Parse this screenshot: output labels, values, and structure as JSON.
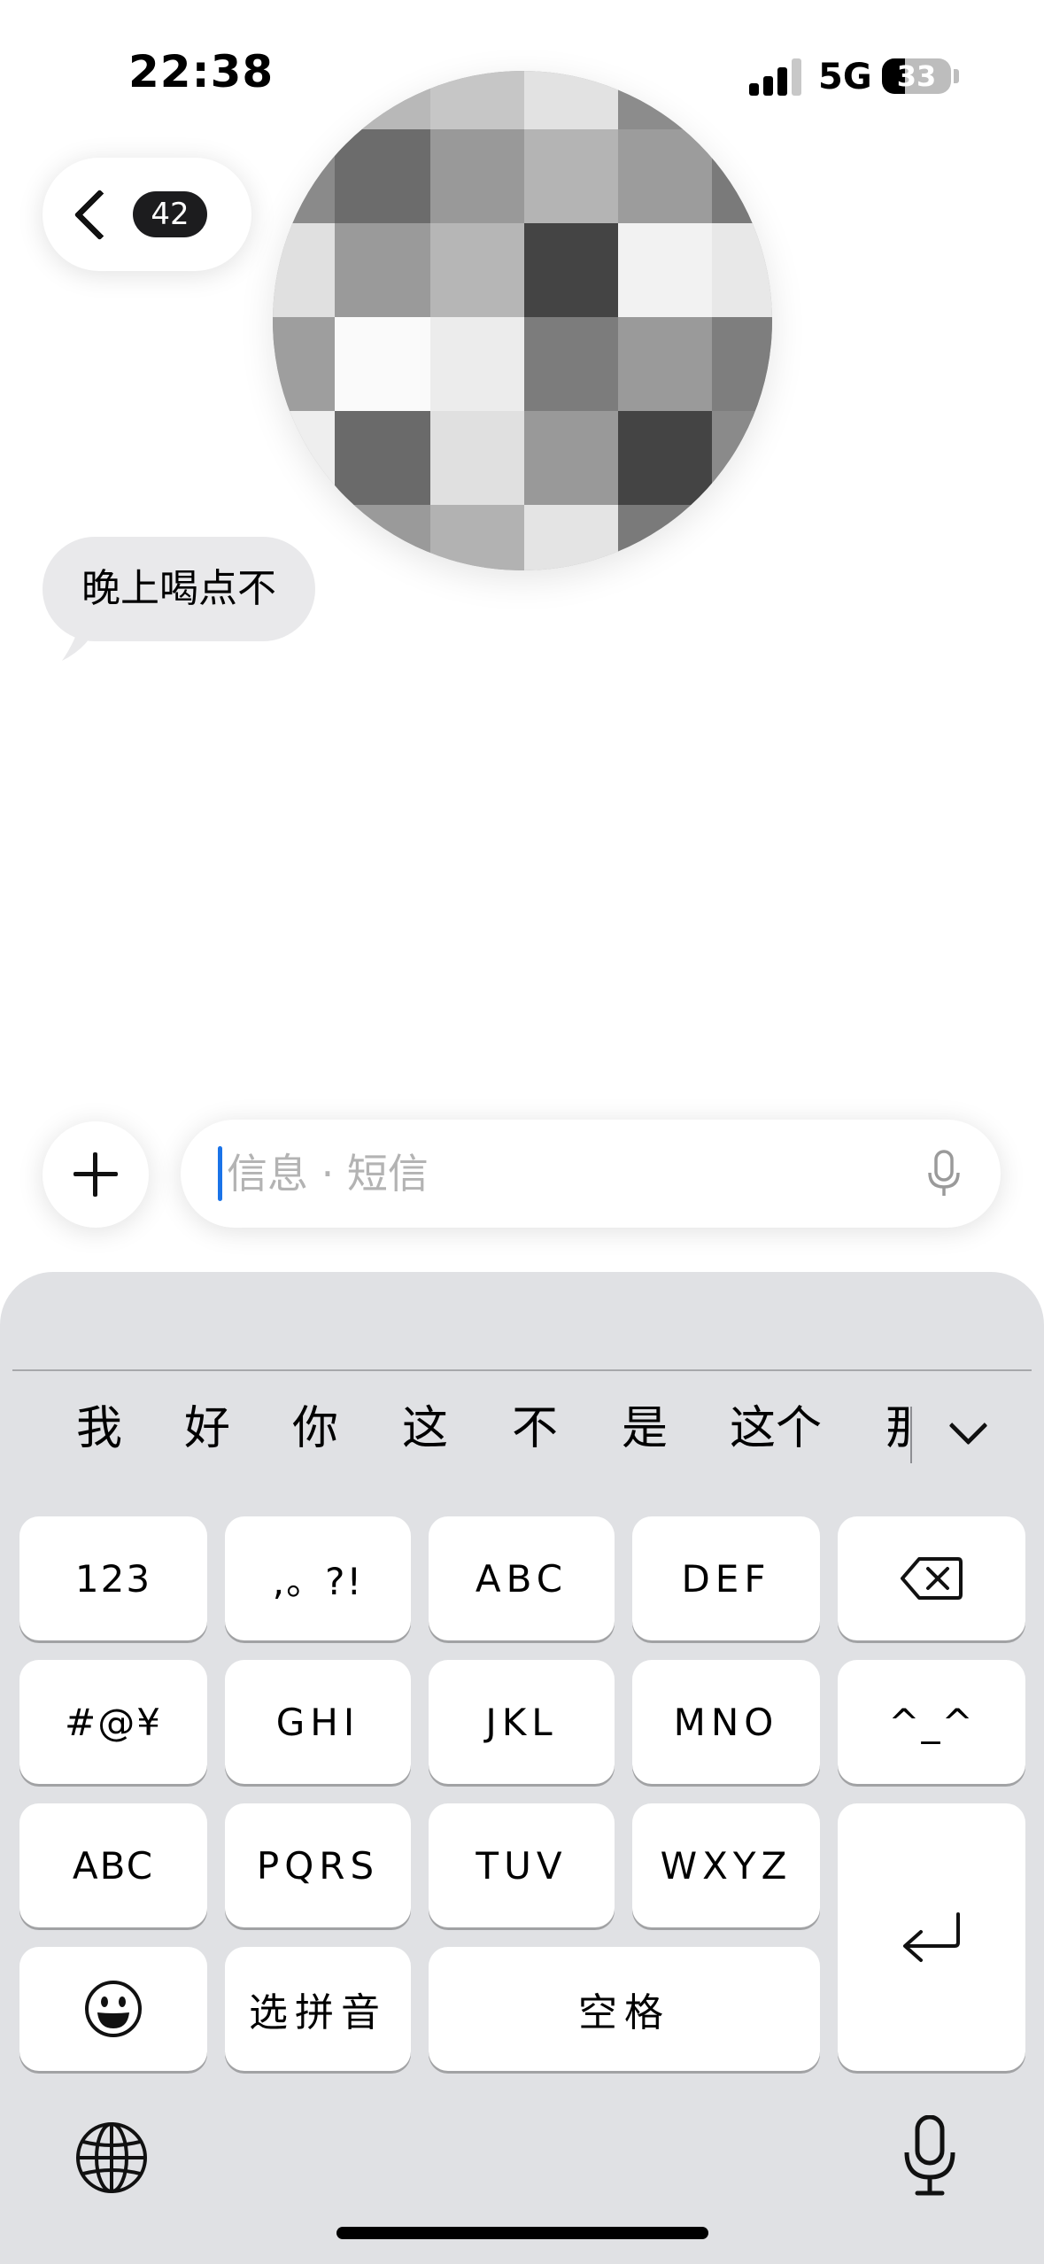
{
  "status_bar": {
    "time": "22:38",
    "network": "5G",
    "battery_percent": "33",
    "signal_bars": 4
  },
  "header": {
    "unread_count": "42",
    "back_icon": "chevron-left-icon",
    "avatar": "contact-avatar (pixelated)"
  },
  "conversation": {
    "messages": [
      {
        "direction": "incoming",
        "text": "晚上喝点不"
      }
    ]
  },
  "compose": {
    "add_icon": "plus-icon",
    "placeholder": "信息 · 短信",
    "mic_icon": "microphone-icon"
  },
  "keyboard": {
    "candidates": [
      "我",
      "好",
      "你",
      "这",
      "不",
      "是",
      "这个",
      "那"
    ],
    "expand_icon": "chevron-down-icon",
    "keys": {
      "k123": "123",
      "punct": ",。?!",
      "abc_top": "ABC",
      "def": "DEF",
      "delete_icon": "delete-backward-icon",
      "symbols": "#@¥",
      "ghi": "GHI",
      "jkl": "JKL",
      "mno": "MNO",
      "emoticon": "^_^",
      "abc_switch": "ABC",
      "pqrs": "PQRS",
      "tuv": "TUV",
      "wxyz": "WXYZ",
      "return_icon": "return-icon",
      "emoji_icon": "emoji-icon",
      "select_pinyin": "选拼音",
      "space": "空格"
    },
    "globe_icon": "globe-icon",
    "dictation_icon": "microphone-icon"
  },
  "colors": {
    "keyboard_bg": "#e0e1e4",
    "key_bg": "#ffffff",
    "incoming_bubble": "#e9e9eb",
    "caret": "#1a73e8",
    "placeholder": "#b3b3b3"
  }
}
